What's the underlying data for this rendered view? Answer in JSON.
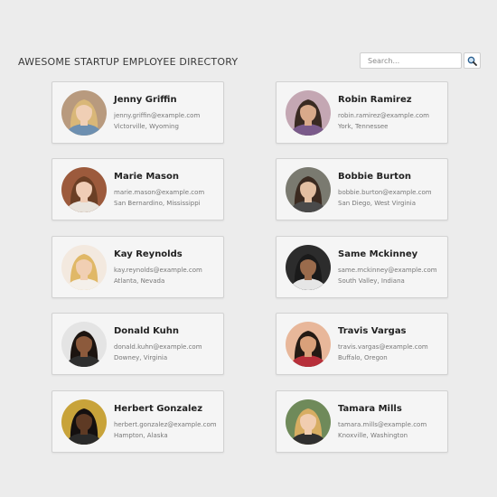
{
  "header": {
    "title": "AWESOME STARTUP EMPLOYEE DIRECTORY"
  },
  "search": {
    "placeholder": "Search...",
    "button_icon": "magnifier-icon"
  },
  "employees": [
    {
      "name": "Jenny Griffin",
      "email": "jenny.griffin@example.com",
      "location": "Victorville, Wyoming",
      "bg": "#b89a7e",
      "skin": "#f0cfb5",
      "hair": "#d9b778",
      "shirt": "#6d8fb0"
    },
    {
      "name": "Robin Ramirez",
      "email": "robin.ramirez@example.com",
      "location": "York, Tennessee",
      "bg": "#c4a7b3",
      "skin": "#d9a98a",
      "hair": "#3a2a22",
      "shirt": "#7a5a8a"
    },
    {
      "name": "Marie Mason",
      "email": "marie.mason@example.com",
      "location": "San Bernardino, Mississippi",
      "bg": "#9c5a3c",
      "skin": "#f0cdb6",
      "hair": "#6b3f25",
      "shirt": "#e9e4dd"
    },
    {
      "name": "Bobbie Burton",
      "email": "bobbie.burton@example.com",
      "location": "San Diego, West Virginia",
      "bg": "#7a7a70",
      "skin": "#e3bfa2",
      "hair": "#3b2a20",
      "shirt": "#4a4a4a"
    },
    {
      "name": "Kay Reynolds",
      "email": "kay.reynolds@example.com",
      "location": "Atlanta, Nevada",
      "bg": "#f3e9df",
      "skin": "#f1cfb3",
      "hair": "#e0b867",
      "shirt": "#f4f0ea"
    },
    {
      "name": "Same Mckinney",
      "email": "same.mckinney@example.com",
      "location": "South Valley, Indiana",
      "bg": "#2c2c2c",
      "skin": "#9a6b4c",
      "hair": "#1a1a1a",
      "shirt": "#e6e6e6"
    },
    {
      "name": "Donald Kuhn",
      "email": "donald.kuhn@example.com",
      "location": "Downey, Virginia",
      "bg": "#e4e4e4",
      "skin": "#8c5a3c",
      "hair": "#1c1410",
      "shirt": "#2e2e2e"
    },
    {
      "name": "Travis Vargas",
      "email": "travis.vargas@example.com",
      "location": "Buffalo, Oregon",
      "bg": "#e8b79a",
      "skin": "#d9a07a",
      "hair": "#241a14",
      "shirt": "#b72f3a"
    },
    {
      "name": "Herbert Gonzalez",
      "email": "herbert.gonzalez@example.com",
      "location": "Hampton, Alaska",
      "bg": "#c8a33a",
      "skin": "#5e3a24",
      "hair": "#141010",
      "shirt": "#2a2a2a"
    },
    {
      "name": "Tamara Mills",
      "email": "tamara.mills@example.com",
      "location": "Knoxville, Washington",
      "bg": "#6f8a5a",
      "skin": "#f1cdb0",
      "hair": "#d7ad62",
      "shirt": "#2f2f2f"
    }
  ]
}
